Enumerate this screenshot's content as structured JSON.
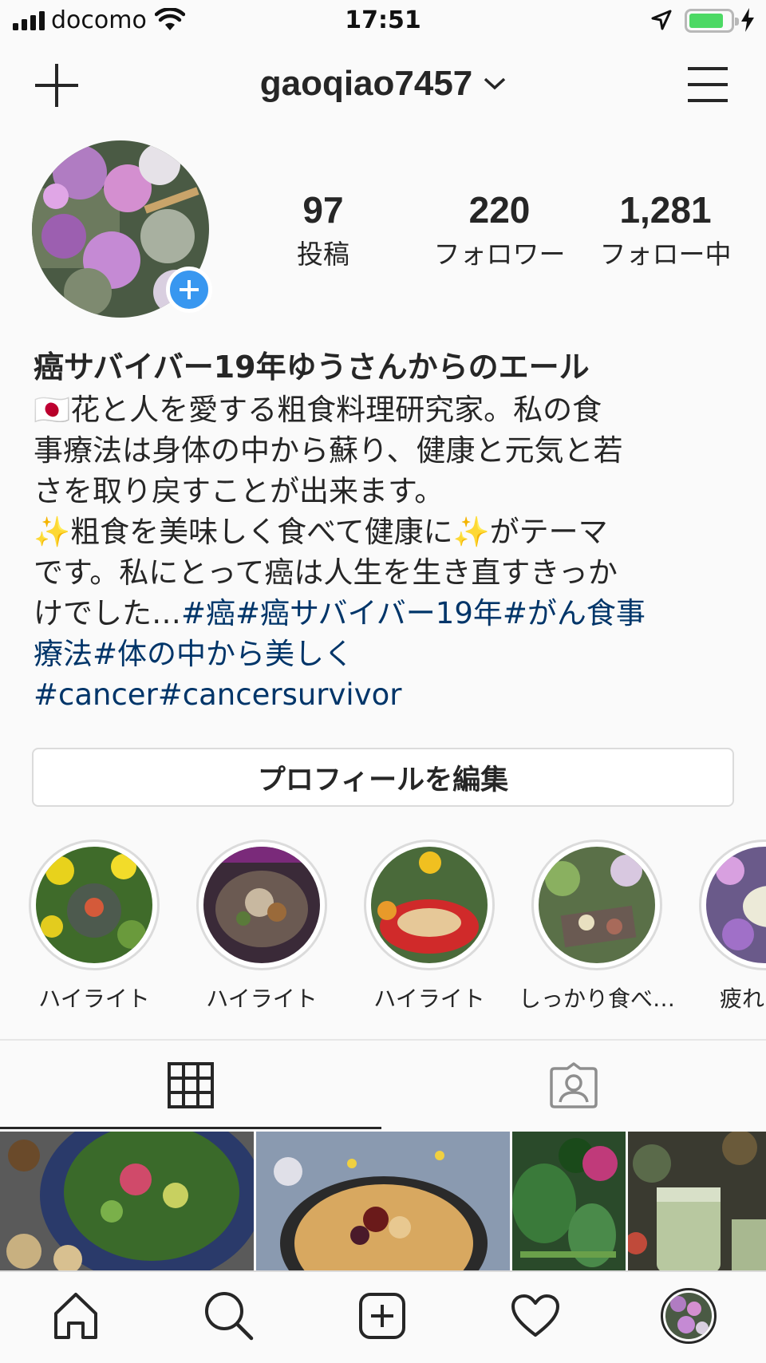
{
  "status_bar": {
    "carrier": "docomo",
    "time": "17:51",
    "battery_color": "#4cd964"
  },
  "header": {
    "username": "gaoqiao7457",
    "icons": [
      "plus-icon",
      "chevron-down-icon",
      "hamburger-menu-icon"
    ]
  },
  "profile": {
    "stats": [
      {
        "count": "97",
        "label": "投稿"
      },
      {
        "count": "220",
        "label": "フォロワー"
      },
      {
        "count": "1,281",
        "label": "フォロー中"
      }
    ],
    "display_name": "癌サバイバー19年ゆうさんからのエール",
    "bio_lines": [
      "🇯🇵花と人を愛する粗食料理研究家。私の食",
      "事療法は身体の中から蘇り、健康と元気と若",
      "さを取り戻すことが出来ます。",
      "✨粗食を美味しく食べて健康に✨がテーマ",
      "です。私にとって癌は人生を生き直すきっか"
    ],
    "bio_tail_plain": "けでした…",
    "bio_tail_tags": "#癌#癌サバイバー19年#がん食事",
    "bio_tags_line2": "療法#体の中から美しく",
    "bio_tags_line3": "#cancer#cancersurvivor",
    "edit_button": "プロフィールを編集",
    "accent_color": "#3897f0",
    "hashtag_color": "#003569"
  },
  "highlights": [
    {
      "label": "ハイライト"
    },
    {
      "label": "ハイライト"
    },
    {
      "label": "ハイライト"
    },
    {
      "label": "しっかり食べ…"
    },
    {
      "label": "疲れた時"
    }
  ],
  "tabs": [
    "grid-icon",
    "tagged-person-icon"
  ],
  "bottom_nav": [
    "home-icon",
    "search-icon",
    "new-post-icon",
    "heart-icon",
    "profile-avatar"
  ]
}
